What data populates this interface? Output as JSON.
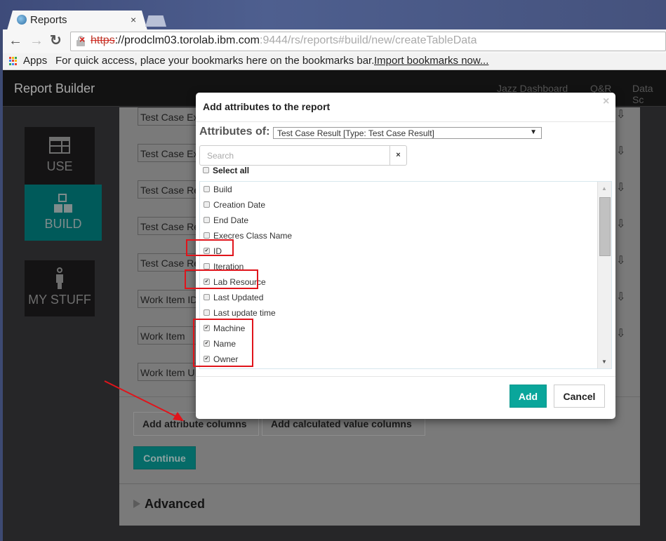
{
  "browser": {
    "tab_title": "Reports",
    "tab_close": "×",
    "url_scheme": "https",
    "url_host": "://prodclm03.torolab.ibm.com",
    "url_rest": ":9444/rs/reports#build/new/createTableData",
    "nav": {
      "back": "←",
      "forward": "→",
      "reload": "↻"
    },
    "bookmarks": {
      "apps_label": "Apps",
      "message": "For quick access, place your bookmarks here on the bookmarks bar.",
      "import_link": "Import bookmarks now..."
    }
  },
  "app": {
    "title": "Report Builder",
    "header_links": [
      "Jazz Dashboard",
      "Q&R",
      "Data Sc"
    ],
    "nav": [
      {
        "label": "USE",
        "icon": "table-icon",
        "active": false
      },
      {
        "label": "BUILD",
        "icon": "blocks-icon",
        "active": true
      },
      {
        "label": "MY STUFF",
        "icon": "person-icon",
        "active": false
      }
    ],
    "fields": [
      "Test Case Ex",
      "Test Case Ex",
      "Test Case Re",
      "Test Case Re",
      "Test Case Re",
      "Work Item ID",
      "Work Item",
      "Work Item UI"
    ],
    "move_down_symbol": "⇩",
    "add_attribute_columns": "Add attribute columns",
    "add_calculated_columns": "Add calculated value columns",
    "continue": "Continue",
    "advanced": "Advanced"
  },
  "modal": {
    "title": "Add attributes to the report",
    "close": "×",
    "attributes_of_label": "Attributes of:",
    "attributes_of_value": "Test Case Result [Type: Test Case Result]",
    "search_placeholder": "Search",
    "search_clear": "×",
    "select_all": "Select all",
    "items": [
      {
        "label": "Build",
        "checked": false
      },
      {
        "label": "Creation Date",
        "checked": false
      },
      {
        "label": "End Date",
        "checked": false
      },
      {
        "label": "Execres Class Name",
        "checked": false
      },
      {
        "label": "ID",
        "checked": true
      },
      {
        "label": "Iteration",
        "checked": false
      },
      {
        "label": "Lab Resource",
        "checked": true
      },
      {
        "label": "Last Updated",
        "checked": false
      },
      {
        "label": "Last update time",
        "checked": false
      },
      {
        "label": "Machine",
        "checked": true
      },
      {
        "label": "Name",
        "checked": true
      },
      {
        "label": "Owner",
        "checked": true
      }
    ],
    "add_button": "Add",
    "cancel_button": "Cancel"
  },
  "colors": {
    "accent_teal": "#0aa69b",
    "build_active": "#005a5a",
    "annotation_red": "#e0141b"
  }
}
